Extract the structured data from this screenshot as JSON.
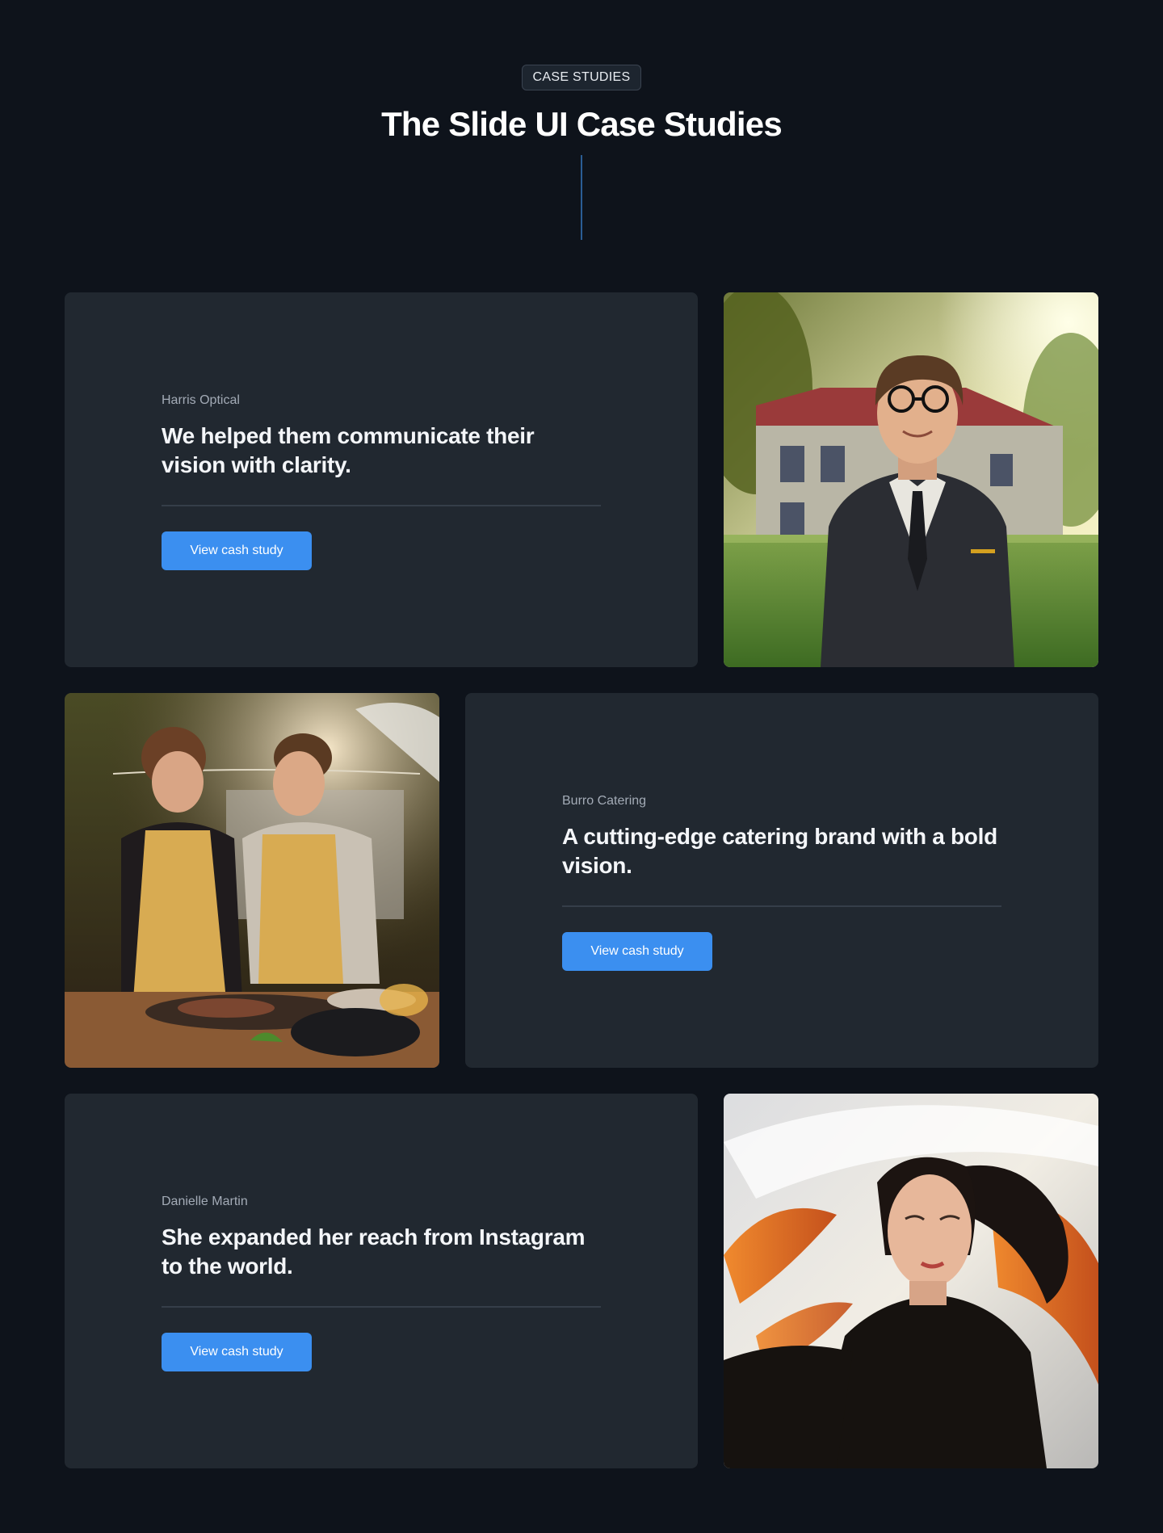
{
  "header": {
    "badge": "CASE STUDIES",
    "title": "The Slide UI Case Studies"
  },
  "colors": {
    "background": "#0e131b",
    "card": "#212830",
    "accent": "#3b8ff0",
    "divider": "#2a5d94"
  },
  "case_studies": [
    {
      "client": "Harris Optical",
      "headline": "We helped them communicate their vision with clarity.",
      "button_label": "View cash study",
      "image": "man-in-suit-with-glasses-portrait"
    },
    {
      "client": "Burro Catering",
      "headline": "A cutting-edge catering brand with a bold vision.",
      "button_label": "View cash study",
      "image": "couple-cooking-outdoor-grill"
    },
    {
      "client": "Danielle Martin",
      "headline": "She expanded her reach from Instagram to the world.",
      "button_label": "View cash study",
      "image": "woman-with-flowing-orange-hair"
    }
  ]
}
